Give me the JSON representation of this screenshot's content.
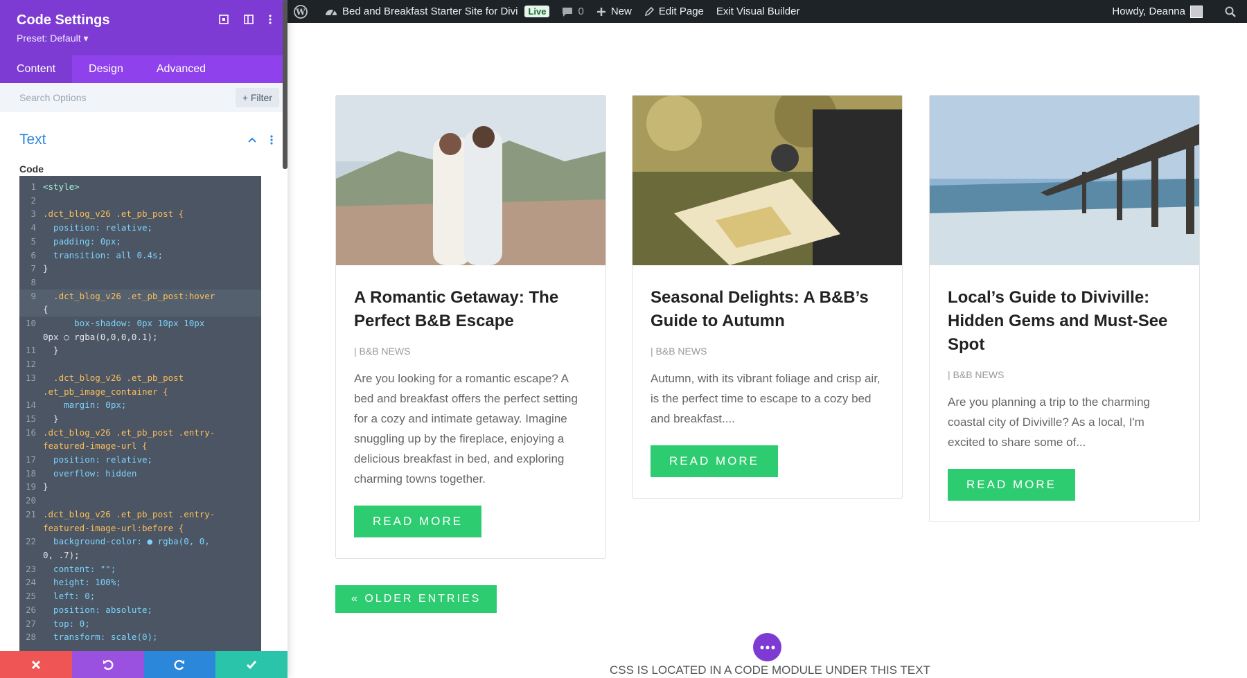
{
  "adminbar": {
    "site_name": "Bed and Breakfast Starter Site for Divi",
    "live_badge": "Live",
    "comments_count": "0",
    "new_label": "New",
    "edit_page_label": "Edit Page",
    "exit_vb_label": "Exit Visual Builder",
    "howdy": "Howdy, Deanna"
  },
  "panel": {
    "title": "Code Settings",
    "preset": "Preset: Default ▾",
    "tabs": [
      "Content",
      "Design",
      "Advanced"
    ],
    "search_placeholder": "Search Options",
    "filter_label": "+ Filter",
    "section_title": "Text",
    "code_label": "Code",
    "code_lines": [
      {
        "n": "1",
        "t": "<style>"
      },
      {
        "n": "2",
        "t": ""
      },
      {
        "n": "3",
        "t": ".dct_blog_v26 .et_pb_post {"
      },
      {
        "n": "4",
        "t": "  position: relative;"
      },
      {
        "n": "5",
        "t": "  padding: 0px;"
      },
      {
        "n": "6",
        "t": "  transition: all 0.4s;"
      },
      {
        "n": "7",
        "t": "}"
      },
      {
        "n": "8",
        "t": ""
      },
      {
        "n": "9",
        "t": "  .dct_blog_v26 .et_pb_post:hover"
      },
      {
        "n": "",
        "t": "{"
      },
      {
        "n": "10",
        "t": "      box-shadow: 0px 10px 10px"
      },
      {
        "n": "",
        "t": "0px ○ rgba(0,0,0,0.1);"
      },
      {
        "n": "11",
        "t": "  }"
      },
      {
        "n": "12",
        "t": ""
      },
      {
        "n": "13",
        "t": "  .dct_blog_v26 .et_pb_post"
      },
      {
        "n": "",
        "t": ".et_pb_image_container {"
      },
      {
        "n": "14",
        "t": "    margin: 0px;"
      },
      {
        "n": "15",
        "t": "  }"
      },
      {
        "n": "16",
        "t": ".dct_blog_v26 .et_pb_post .entry-"
      },
      {
        "n": "",
        "t": "featured-image-url {"
      },
      {
        "n": "17",
        "t": "  position: relative;"
      },
      {
        "n": "18",
        "t": "  overflow: hidden"
      },
      {
        "n": "19",
        "t": "}"
      },
      {
        "n": "20",
        "t": ""
      },
      {
        "n": "21",
        "t": ".dct_blog_v26 .et_pb_post .entry-"
      },
      {
        "n": "",
        "t": "featured-image-url:before {"
      },
      {
        "n": "22",
        "t": "  background-color: ● rgba(0, 0,"
      },
      {
        "n": "",
        "t": "0, .7);"
      },
      {
        "n": "23",
        "t": "  content: \"\";"
      },
      {
        "n": "24",
        "t": "  height: 100%;"
      },
      {
        "n": "25",
        "t": "  left: 0;"
      },
      {
        "n": "26",
        "t": "  position: absolute;"
      },
      {
        "n": "27",
        "t": "  top: 0;"
      },
      {
        "n": "28",
        "t": "  transform: scale(0);"
      }
    ]
  },
  "posts": [
    {
      "title": "A Romantic Getaway: The Perfect B&B Escape",
      "meta": "| B&B NEWS",
      "excerpt": "Are you looking for a romantic escape? A bed and breakfast offers the perfect setting for a cozy and intimate getaway. Imagine snuggling up by the fireplace, enjoying a delicious breakfast in bed, and exploring charming towns together.",
      "button": "READ MORE"
    },
    {
      "title": "Seasonal Delights: A B&B’s Guide to Autumn",
      "meta": "| B&B NEWS",
      "excerpt": "Autumn, with its vibrant foliage and crisp air, is the perfect time to escape to a cozy bed and breakfast....",
      "button": "READ MORE"
    },
    {
      "title": "Local’s Guide to Diviville: Hidden Gems and Must-See Spot",
      "meta": "| B&B NEWS",
      "excerpt": "Are you planning a trip to the charming coastal city of Diviville? As a local, I'm excited to share some of...",
      "button": "READ MORE"
    }
  ],
  "older_entries": "« OLDER ENTRIES",
  "css_note": "CSS IS LOCATED IN A CODE MODULE UNDER THIS TEXT",
  "colors": {
    "panel_purple": "#7d3bd4",
    "tab_purple": "#8f42ec",
    "button_green": "#2ecc71",
    "cancel_red": "#ef5555",
    "undo_purple": "#9b51e0",
    "redo_blue": "#2b87da",
    "save_green": "#29c4a9"
  }
}
